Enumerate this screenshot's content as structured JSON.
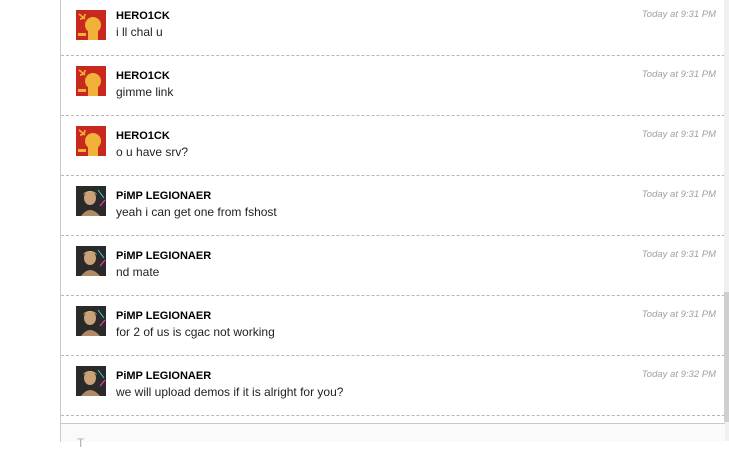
{
  "messages": [
    {
      "author": "HERO1CK",
      "text": "i ll chal u",
      "time": "Today at 9:31 PM",
      "avatar": "hammer-fist-icon"
    },
    {
      "author": "HERO1CK",
      "text": "gimme link",
      "time": "Today at 9:31 PM",
      "avatar": "hammer-fist-icon"
    },
    {
      "author": "HERO1CK",
      "text": "o u have srv?",
      "time": "Today at 9:31 PM",
      "avatar": "hammer-fist-icon"
    },
    {
      "author": "PiMP LEGIONAER",
      "text": "yeah i can get one from fshost",
      "time": "Today at 9:31 PM",
      "avatar": "user-photo"
    },
    {
      "author": "PiMP LEGIONAER",
      "text": "nd mate",
      "time": "Today at 9:31 PM",
      "avatar": "user-photo"
    },
    {
      "author": "PiMP LEGIONAER",
      "text": "for 2 of us is cgac not working",
      "time": "Today at 9:31 PM",
      "avatar": "user-photo"
    },
    {
      "author": "PiMP LEGIONAER",
      "text": "we will upload demos if it is alright for you?",
      "time": "Today at 9:32 PM",
      "avatar": "user-photo"
    }
  ],
  "composer": {
    "partial_text": "T"
  },
  "colors": {
    "hero_bg": "#c8281e",
    "fist": "#f2b23a"
  }
}
